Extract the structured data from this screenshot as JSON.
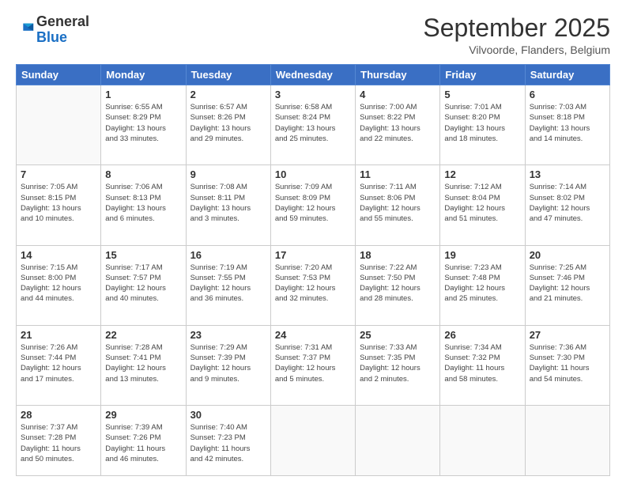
{
  "logo": {
    "general": "General",
    "blue": "Blue"
  },
  "title": "September 2025",
  "location": "Vilvoorde, Flanders, Belgium",
  "weekdays": [
    "Sunday",
    "Monday",
    "Tuesday",
    "Wednesday",
    "Thursday",
    "Friday",
    "Saturday"
  ],
  "weeks": [
    [
      {
        "day": "",
        "info": ""
      },
      {
        "day": "1",
        "info": "Sunrise: 6:55 AM\nSunset: 8:29 PM\nDaylight: 13 hours\nand 33 minutes."
      },
      {
        "day": "2",
        "info": "Sunrise: 6:57 AM\nSunset: 8:26 PM\nDaylight: 13 hours\nand 29 minutes."
      },
      {
        "day": "3",
        "info": "Sunrise: 6:58 AM\nSunset: 8:24 PM\nDaylight: 13 hours\nand 25 minutes."
      },
      {
        "day": "4",
        "info": "Sunrise: 7:00 AM\nSunset: 8:22 PM\nDaylight: 13 hours\nand 22 minutes."
      },
      {
        "day": "5",
        "info": "Sunrise: 7:01 AM\nSunset: 8:20 PM\nDaylight: 13 hours\nand 18 minutes."
      },
      {
        "day": "6",
        "info": "Sunrise: 7:03 AM\nSunset: 8:18 PM\nDaylight: 13 hours\nand 14 minutes."
      }
    ],
    [
      {
        "day": "7",
        "info": "Sunrise: 7:05 AM\nSunset: 8:15 PM\nDaylight: 13 hours\nand 10 minutes."
      },
      {
        "day": "8",
        "info": "Sunrise: 7:06 AM\nSunset: 8:13 PM\nDaylight: 13 hours\nand 6 minutes."
      },
      {
        "day": "9",
        "info": "Sunrise: 7:08 AM\nSunset: 8:11 PM\nDaylight: 13 hours\nand 3 minutes."
      },
      {
        "day": "10",
        "info": "Sunrise: 7:09 AM\nSunset: 8:09 PM\nDaylight: 12 hours\nand 59 minutes."
      },
      {
        "day": "11",
        "info": "Sunrise: 7:11 AM\nSunset: 8:06 PM\nDaylight: 12 hours\nand 55 minutes."
      },
      {
        "day": "12",
        "info": "Sunrise: 7:12 AM\nSunset: 8:04 PM\nDaylight: 12 hours\nand 51 minutes."
      },
      {
        "day": "13",
        "info": "Sunrise: 7:14 AM\nSunset: 8:02 PM\nDaylight: 12 hours\nand 47 minutes."
      }
    ],
    [
      {
        "day": "14",
        "info": "Sunrise: 7:15 AM\nSunset: 8:00 PM\nDaylight: 12 hours\nand 44 minutes."
      },
      {
        "day": "15",
        "info": "Sunrise: 7:17 AM\nSunset: 7:57 PM\nDaylight: 12 hours\nand 40 minutes."
      },
      {
        "day": "16",
        "info": "Sunrise: 7:19 AM\nSunset: 7:55 PM\nDaylight: 12 hours\nand 36 minutes."
      },
      {
        "day": "17",
        "info": "Sunrise: 7:20 AM\nSunset: 7:53 PM\nDaylight: 12 hours\nand 32 minutes."
      },
      {
        "day": "18",
        "info": "Sunrise: 7:22 AM\nSunset: 7:50 PM\nDaylight: 12 hours\nand 28 minutes."
      },
      {
        "day": "19",
        "info": "Sunrise: 7:23 AM\nSunset: 7:48 PM\nDaylight: 12 hours\nand 25 minutes."
      },
      {
        "day": "20",
        "info": "Sunrise: 7:25 AM\nSunset: 7:46 PM\nDaylight: 12 hours\nand 21 minutes."
      }
    ],
    [
      {
        "day": "21",
        "info": "Sunrise: 7:26 AM\nSunset: 7:44 PM\nDaylight: 12 hours\nand 17 minutes."
      },
      {
        "day": "22",
        "info": "Sunrise: 7:28 AM\nSunset: 7:41 PM\nDaylight: 12 hours\nand 13 minutes."
      },
      {
        "day": "23",
        "info": "Sunrise: 7:29 AM\nSunset: 7:39 PM\nDaylight: 12 hours\nand 9 minutes."
      },
      {
        "day": "24",
        "info": "Sunrise: 7:31 AM\nSunset: 7:37 PM\nDaylight: 12 hours\nand 5 minutes."
      },
      {
        "day": "25",
        "info": "Sunrise: 7:33 AM\nSunset: 7:35 PM\nDaylight: 12 hours\nand 2 minutes."
      },
      {
        "day": "26",
        "info": "Sunrise: 7:34 AM\nSunset: 7:32 PM\nDaylight: 11 hours\nand 58 minutes."
      },
      {
        "day": "27",
        "info": "Sunrise: 7:36 AM\nSunset: 7:30 PM\nDaylight: 11 hours\nand 54 minutes."
      }
    ],
    [
      {
        "day": "28",
        "info": "Sunrise: 7:37 AM\nSunset: 7:28 PM\nDaylight: 11 hours\nand 50 minutes."
      },
      {
        "day": "29",
        "info": "Sunrise: 7:39 AM\nSunset: 7:26 PM\nDaylight: 11 hours\nand 46 minutes."
      },
      {
        "day": "30",
        "info": "Sunrise: 7:40 AM\nSunset: 7:23 PM\nDaylight: 11 hours\nand 42 minutes."
      },
      {
        "day": "",
        "info": ""
      },
      {
        "day": "",
        "info": ""
      },
      {
        "day": "",
        "info": ""
      },
      {
        "day": "",
        "info": ""
      }
    ]
  ]
}
